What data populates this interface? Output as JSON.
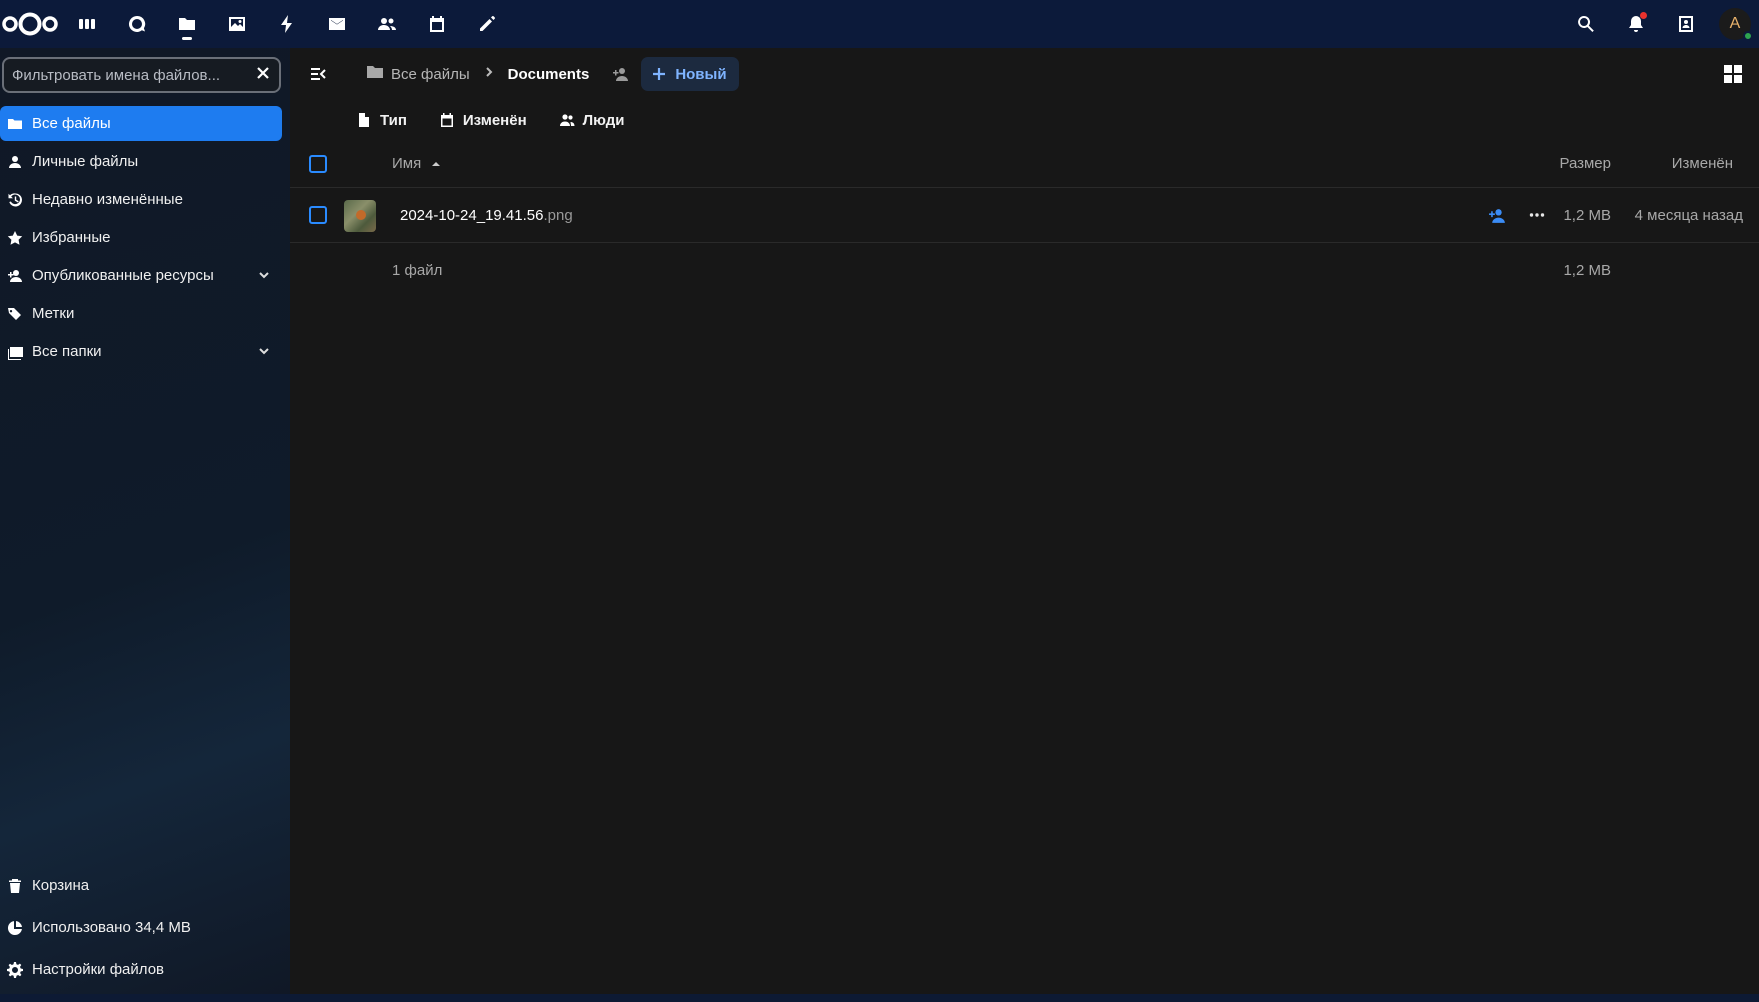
{
  "header": {
    "apps": [
      {
        "name": "dashboard-icon"
      },
      {
        "name": "search-talk-icon"
      },
      {
        "name": "files-icon",
        "active": true
      },
      {
        "name": "photos-icon"
      },
      {
        "name": "activity-icon"
      },
      {
        "name": "mail-icon"
      },
      {
        "name": "contacts-icon"
      },
      {
        "name": "calendar-icon"
      },
      {
        "name": "notes-icon"
      }
    ],
    "avatar_initial": "A"
  },
  "sidebar": {
    "filter_placeholder": "Фильтровать имена файлов...",
    "items": [
      {
        "label": "Все файлы",
        "icon": "folder-icon",
        "active": true
      },
      {
        "label": "Личные файлы",
        "icon": "user-icon"
      },
      {
        "label": "Недавно изменённые",
        "icon": "history-icon"
      },
      {
        "label": "Избранные",
        "icon": "star-icon"
      },
      {
        "label": "Опубликованные ресурсы",
        "icon": "share-icon",
        "expandable": true
      },
      {
        "label": "Метки",
        "icon": "tag-icon"
      },
      {
        "label": "Все папки",
        "icon": "folders-icon",
        "expandable": true
      }
    ],
    "bottom": {
      "trash": "Корзина",
      "quota": "Использовано 34,4 MB",
      "settings": "Настройки файлов"
    }
  },
  "toolbar": {
    "breadcrumb_root": "Все файлы",
    "breadcrumb_current": "Documents",
    "new_label": "Новый"
  },
  "filters": {
    "type": "Тип",
    "modified": "Изменён",
    "people": "Люди"
  },
  "table": {
    "headers": {
      "name": "Имя",
      "size": "Размер",
      "modified": "Изменён"
    },
    "rows": [
      {
        "basename": "2024-10-24_19.41.56",
        "ext": ".png",
        "size": "1,2 MB",
        "modified": "4 месяца назад"
      }
    ],
    "summary": {
      "count": "1 файл",
      "total": "1,2 MB"
    }
  },
  "colors": {
    "accent": "#1e7cf0",
    "header_bg": "#0c1a3a",
    "main_bg": "#171717"
  }
}
